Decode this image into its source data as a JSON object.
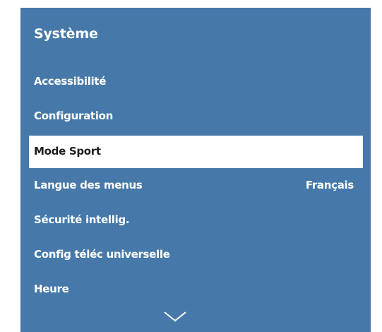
{
  "panel": {
    "title": "Système",
    "background_color": "#4679a9",
    "selected_color": "#ffffff"
  },
  "menu": {
    "items": [
      {
        "label": "Accessibilité",
        "value": ""
      },
      {
        "label": "Configuration",
        "value": ""
      },
      {
        "label": "Mode Sport",
        "value": "",
        "selected": true
      },
      {
        "label": "Langue des menus",
        "value": "Français"
      },
      {
        "label": "Sécurité intellig.",
        "value": ""
      },
      {
        "label": "Config téléc universelle",
        "value": ""
      },
      {
        "label": "Heure",
        "value": ""
      }
    ]
  },
  "scroll": {
    "icon": "chevron-down-icon"
  }
}
